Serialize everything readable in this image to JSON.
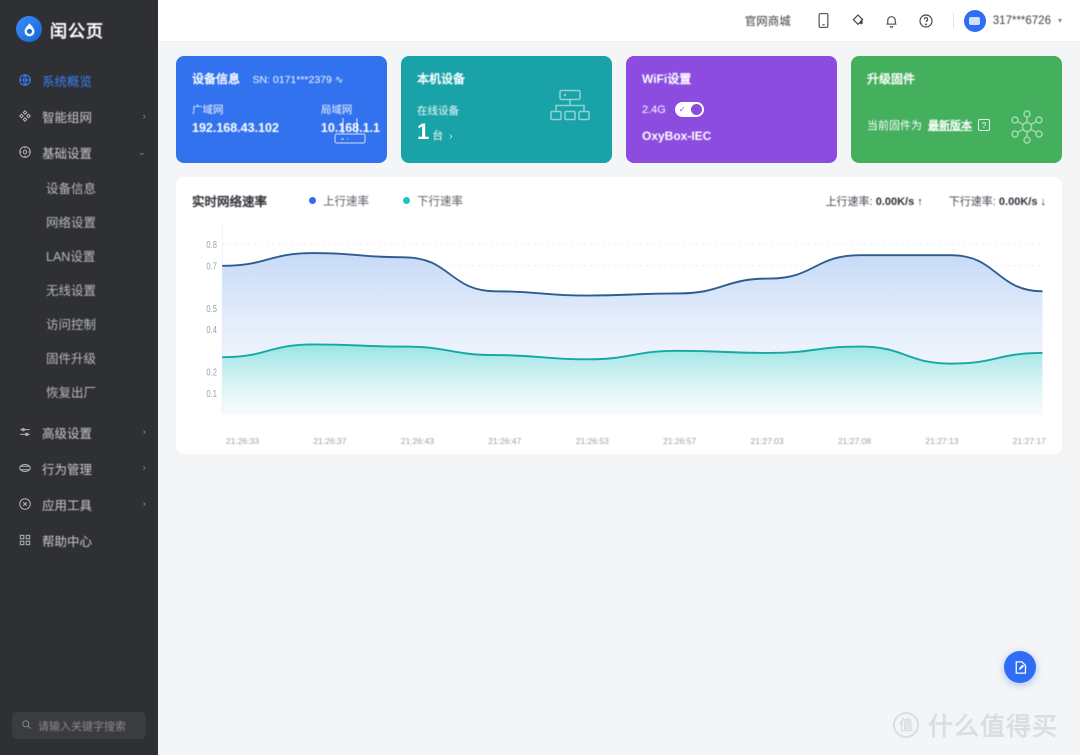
{
  "brand": {
    "name": "闰公页",
    "logo_icon": "droplet-logo-icon"
  },
  "sidebar": {
    "items": [
      {
        "label": "系统概览",
        "icon": "globe-icon",
        "active": true,
        "arrow": ""
      },
      {
        "label": "智能组网",
        "icon": "network-node-icon",
        "active": false,
        "arrow": "›"
      },
      {
        "label": "基础设置",
        "icon": "gear-circle-icon",
        "active": false,
        "arrow": "⌄"
      }
    ],
    "sub_items": [
      {
        "label": "设备信息"
      },
      {
        "label": "网络设置"
      },
      {
        "label": "LAN设置"
      },
      {
        "label": "无线设置"
      },
      {
        "label": "访问控制"
      },
      {
        "label": "固件升级"
      },
      {
        "label": "恢复出厂"
      }
    ],
    "items_bottom": [
      {
        "label": "高级设置",
        "icon": "sliders-icon",
        "arrow": "›"
      },
      {
        "label": "行为管理",
        "icon": "shield-icon",
        "arrow": "›"
      },
      {
        "label": "应用工具",
        "icon": "tools-icon",
        "arrow": "›"
      },
      {
        "label": "帮助中心",
        "icon": "grid-icon",
        "arrow": ""
      }
    ],
    "search": {
      "placeholder": "请输入关键字搜索",
      "icon": "search-icon"
    }
  },
  "topbar": {
    "text_label": "官网商城",
    "icons": [
      {
        "name": "mobile-app-icon"
      },
      {
        "name": "theme-palette-icon"
      },
      {
        "name": "notification-bell-icon"
      },
      {
        "name": "help-circle-icon"
      }
    ],
    "user": {
      "name": "317***6726",
      "caret": "▾",
      "avatar_icon": "user-avatar"
    }
  },
  "cards": [
    {
      "key": "device",
      "color": "#3272ef",
      "title": "设备信息",
      "sn": "SN: 0171***2379 ∿",
      "fields": [
        {
          "label": "广域网",
          "value": "192.168.43.102"
        },
        {
          "label": "局域网",
          "value": "10.168.1.1"
        }
      ],
      "art_icon": "router-icon"
    },
    {
      "key": "topology",
      "color": "#19a3a8",
      "title": "本机设备",
      "sub": "在线设备",
      "count": "1",
      "unit": "台",
      "chevron": "›",
      "art_icon": "network-topology-icon"
    },
    {
      "key": "wifi",
      "color": "#8c4ce0",
      "title": "WiFi设置",
      "band": "2.4G",
      "toggle_on": true,
      "ssid": "OxyBox-IEC",
      "art_icon": "wifi-icon"
    },
    {
      "key": "upgrade",
      "color": "#44b05e",
      "title": "升级固件",
      "status_text": "当前固件为",
      "status_link": "最新版本",
      "help_icon": "help-square-icon",
      "art_icon": "atom-settings-icon"
    }
  ],
  "chart_panel": {
    "title": "实时网络速率",
    "legend": [
      {
        "label": "上行速率",
        "color": "#2f6df4"
      },
      {
        "label": "下行速率",
        "color": "#1ec3bf"
      }
    ],
    "stats": [
      {
        "label": "上行速率:",
        "value": "0.00K/s ↑"
      },
      {
        "label": "下行速率:",
        "value": "0.00K/s ↓"
      }
    ]
  },
  "chart_data": {
    "type": "area",
    "title": "实时网络速率",
    "xlabel": "",
    "ylabel": "",
    "ylim": [
      0,
      0.9
    ],
    "yticks": [
      0.8,
      0.7,
      0.5,
      0.4,
      0.2,
      0.1
    ],
    "grid": true,
    "legend_position": "top",
    "x": [
      "21:26:33",
      "21:26:37",
      "21:26:43",
      "21:26:47",
      "21:26:53",
      "21:26:57",
      "21:27:03",
      "21:27:08",
      "21:27:13",
      "21:27:17"
    ],
    "series": [
      {
        "name": "上行速率",
        "color": "#2f6df4",
        "line_color": "#2d5d8f",
        "values": [
          0.7,
          0.76,
          0.74,
          0.58,
          0.56,
          0.57,
          0.64,
          0.75,
          0.75,
          0.58
        ]
      },
      {
        "name": "下行速率",
        "color": "#1ec3bf",
        "line_color": "#15a8a5",
        "values": [
          0.27,
          0.33,
          0.32,
          0.28,
          0.26,
          0.3,
          0.29,
          0.32,
          0.24,
          0.29
        ]
      }
    ]
  },
  "fab": {
    "icon": "feedback-edit-icon"
  },
  "watermark": {
    "mark": "值",
    "text": "什么值得买"
  }
}
